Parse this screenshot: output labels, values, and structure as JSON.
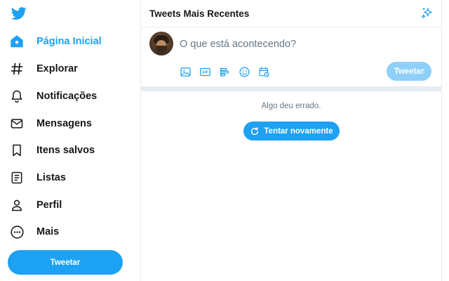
{
  "sidebar": {
    "logo_icon": "twitter-bird-icon",
    "items": [
      {
        "label": "Página Inicial",
        "icon": "home-icon"
      },
      {
        "label": "Explorar",
        "icon": "hashtag-icon"
      },
      {
        "label": "Notificações",
        "icon": "bell-icon"
      },
      {
        "label": "Mensagens",
        "icon": "envelope-icon"
      },
      {
        "label": "Itens salvos",
        "icon": "bookmark-icon"
      },
      {
        "label": "Listas",
        "icon": "list-icon"
      },
      {
        "label": "Perfil",
        "icon": "person-icon"
      },
      {
        "label": "Mais",
        "icon": "more-icon"
      }
    ],
    "tweet_button": "Tweetar"
  },
  "header": {
    "title": "Tweets Mais Recentes",
    "action_icon": "sparkle-icon"
  },
  "composer": {
    "placeholder": "O que está acontecendo?",
    "value": "",
    "tools": [
      "image-icon",
      "gif-icon",
      "poll-icon",
      "emoji-icon",
      "schedule-icon"
    ],
    "gif_label": "GIF",
    "tweet_button": "Tweetar"
  },
  "timeline": {
    "error_message": "Algo deu errado.",
    "retry_button": "Tentar novamente"
  },
  "colors": {
    "accent": "#1da1f2",
    "accent_disabled": "#8ed0f9",
    "text_primary": "#14171a",
    "text_secondary": "#657786",
    "border": "#e6ecf0"
  }
}
